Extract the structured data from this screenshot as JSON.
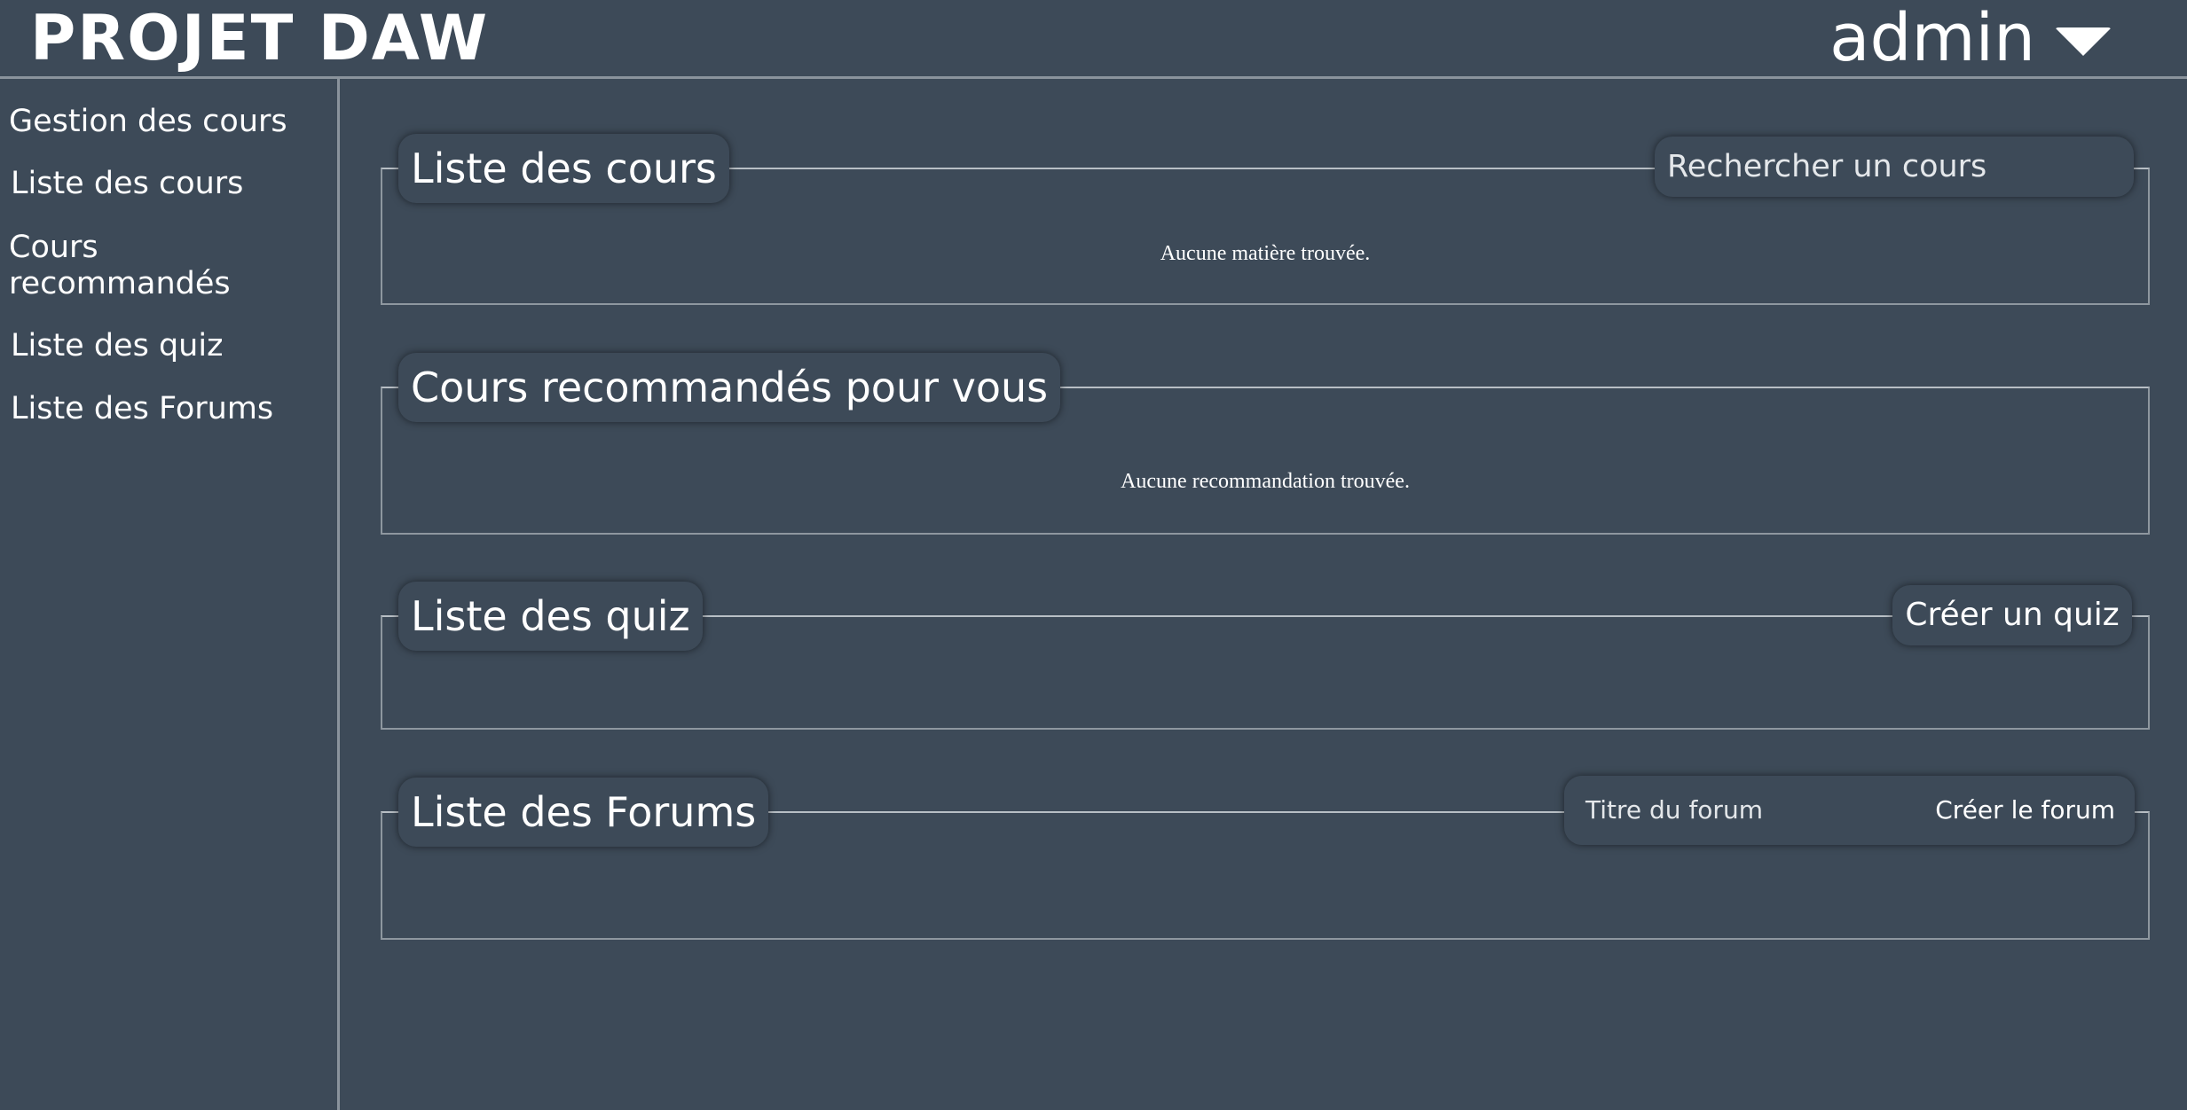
{
  "header": {
    "title": "PROJET DAW",
    "user": "admin"
  },
  "sidebar": {
    "items": [
      {
        "label": "Gestion des cours"
      },
      {
        "label": "Liste des cours"
      },
      {
        "label": "Cours recommandés"
      },
      {
        "label": "Liste des quiz"
      },
      {
        "label": "Liste des Forums"
      }
    ]
  },
  "sections": {
    "courses": {
      "title": "Liste des cours",
      "search_placeholder": "Rechercher un cours",
      "empty_message": "Aucune matière trouvée."
    },
    "recommended": {
      "title": "Cours recommandés pour vous",
      "empty_message": "Aucune recommandation trouvée."
    },
    "quiz": {
      "title": "Liste des quiz",
      "create_button": "Créer un quiz"
    },
    "forums": {
      "title": "Liste des Forums",
      "forum_title_placeholder": "Titre du forum",
      "create_button": "Créer le forum"
    }
  },
  "colors": {
    "background": "#3d4a58",
    "text": "#ffffff",
    "border": "#8e979f"
  },
  "icons": {
    "user_menu": "caret-down-icon"
  }
}
